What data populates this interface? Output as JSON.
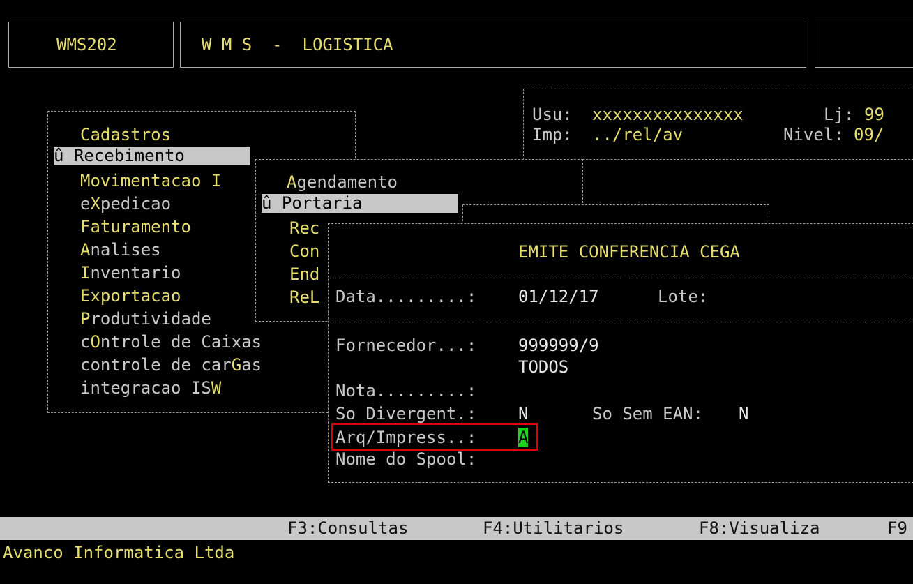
{
  "header": {
    "program": "WMS202",
    "title": "W M S  -  LOGISTICA"
  },
  "user_info": {
    "usu_label": "Usu:",
    "usu_value": "xxxxxxxxxxxxxxx",
    "lj_label": "Lj:",
    "lj_value": "99",
    "imp_label": "Imp:",
    "imp_value": "../rel/av",
    "nivel_label": "Nivel:",
    "nivel_value": "09/"
  },
  "main_menu": {
    "items": [
      {
        "rest": "Cadastros",
        "hot": ""
      },
      {
        "marker": "û",
        "rest": "ecebimento",
        "hot": "R",
        "selected": true
      },
      {
        "hot": "",
        "rest": "Movimentacao I"
      },
      {
        "pre": "e",
        "hot": "X",
        "rest": "pedicao"
      },
      {
        "hot": "",
        "rest": "Faturamento"
      },
      {
        "hot": "A",
        "rest": "nalises"
      },
      {
        "hot": "I",
        "rest": "nventario"
      },
      {
        "hot": "",
        "rest": "Exportacao"
      },
      {
        "hot": "P",
        "rest": "rodutividade"
      },
      {
        "pre": "c",
        "hot": "O",
        "rest": "ntrole de Caixas"
      },
      {
        "pre": "controle de car",
        "hot": "G",
        "rest": "as"
      },
      {
        "pre": "integracao IS",
        "hot": "W",
        "rest": ""
      }
    ]
  },
  "sub_menu": {
    "items": [
      {
        "hot": "A",
        "rest": "gendamento"
      },
      {
        "marker": "û",
        "hot": "P",
        "rest": "ortaria",
        "selected": true
      },
      {
        "hot": "Rec",
        "rest": ""
      },
      {
        "hot": "Con",
        "rest": ""
      },
      {
        "hot": "End",
        "rest": ""
      },
      {
        "hot": "ReL",
        "rest": ""
      }
    ]
  },
  "dialog": {
    "title": "EMITE CONFERENCIA CEGA",
    "data_label": "Data.........:",
    "data_value": "01/12/17",
    "lote_label": "Lote:",
    "fornecedor_label": "Fornecedor...:",
    "fornecedor_value": "999999/9",
    "fornecedor_name": "TODOS",
    "nota_label": "Nota.........:",
    "so_div_label": "So Divergent.:",
    "so_div_value": "N",
    "so_sem_ean_label": "So Sem EAN:",
    "so_sem_ean_value": "N",
    "arq_label": "Arq/Impress..:",
    "arq_value": "A",
    "spool_label": "Nome do Spool:"
  },
  "function_keys": {
    "f3": "F3:Consultas",
    "f4": "F4:Utilitarios",
    "f8": "F8:Visualiza",
    "f9": "F9"
  },
  "footer": {
    "company": "Avanco Informatica Ltda"
  },
  "colors": {
    "background": "#000000",
    "text_yellow": "#e6dd6f",
    "text_grey": "#c8c8c8",
    "highlight": "#c8c8c8",
    "cursor": "#1fd11f",
    "focus_box": "#e10000"
  }
}
